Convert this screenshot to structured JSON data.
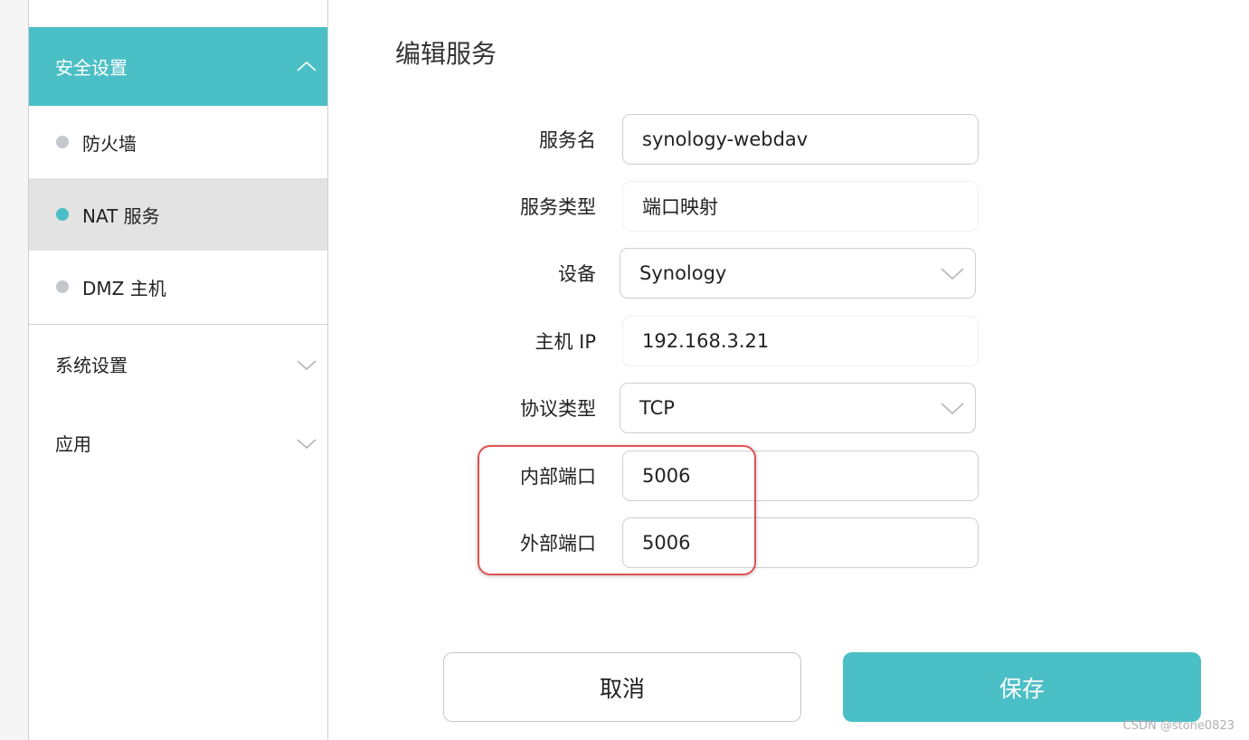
{
  "sidebar": {
    "security_group": {
      "label": "安全设置",
      "expanded": true
    },
    "items": [
      {
        "label": "防火墙",
        "selected": false
      },
      {
        "label": "NAT 服务",
        "selected": true
      },
      {
        "label": "DMZ 主机",
        "selected": false
      }
    ],
    "system_group": {
      "label": "系统设置"
    },
    "apps_group": {
      "label": "应用"
    }
  },
  "form": {
    "title": "编辑服务",
    "service_name": {
      "label": "服务名",
      "value": "synology-webdav"
    },
    "service_type": {
      "label": "服务类型",
      "value": "端口映射"
    },
    "device": {
      "label": "设备",
      "value": "Synology"
    },
    "host_ip": {
      "label": "主机 IP",
      "value": "192.168.3.21"
    },
    "protocol": {
      "label": "协议类型",
      "value": "TCP"
    },
    "internal_port": {
      "label": "内部端口",
      "value": "5006"
    },
    "external_port": {
      "label": "外部端口",
      "value": "5006"
    }
  },
  "buttons": {
    "cancel": "取消",
    "save": "保存"
  },
  "watermark": "CSDN @stone0823",
  "colors": {
    "accent": "#4bbfc6",
    "highlight": "#e05353",
    "selected_bg": "#e3e3e3"
  }
}
